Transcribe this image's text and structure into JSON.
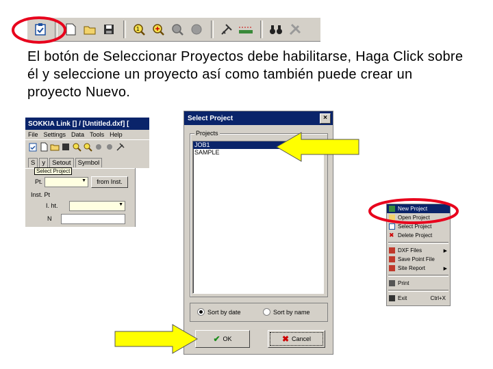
{
  "toolbar": {
    "buttons": [
      "select-project",
      "new",
      "open",
      "save",
      "zoom-extents",
      "zoom-in",
      "zoom-window",
      "pan",
      "draw",
      "measure",
      "find",
      "settings"
    ]
  },
  "instructions": {
    "text": "El botón de Seleccionar Proyectos debe habilitarse, Haga Click sobre él y seleccione un proyecto así como también puede crear un proyecto Nuevo."
  },
  "app": {
    "title": "SOKKIA Link  [] / [Untitled.dxf]  [",
    "menu": [
      "File",
      "Settings",
      "Data",
      "Tools",
      "Help"
    ],
    "tabs": [
      "S",
      "y",
      "Setout",
      "Symbol"
    ],
    "pt_label": "Pt.",
    "from_inst": "from Inst.",
    "inst_pt": "Inst. Pt",
    "ht_label": "I. ht.",
    "n_label": "N",
    "tooltip": "Select Project"
  },
  "dialog": {
    "title": "Select Project",
    "group_label": "Projects",
    "projects": [
      "JOB1",
      "SAMPLE"
    ],
    "selected_index": 0,
    "sort_by_date": "Sort by date",
    "sort_by_name": "Sort by name",
    "ok": "OK",
    "cancel": "Cancel",
    "close": "×"
  },
  "context_menu": {
    "items": [
      {
        "label": "New Project",
        "highlight": true
      },
      {
        "label": "Open Project",
        "highlight": false
      },
      {
        "label": "Select Project",
        "highlight": false
      },
      {
        "label": "Delete Project",
        "highlight": false
      }
    ],
    "items2": [
      {
        "label": "DXF Files",
        "submenu": true
      },
      {
        "label": "Save Point File",
        "submenu": false
      },
      {
        "label": "Site Report",
        "submenu": true
      }
    ],
    "print": "Print",
    "exit": "Exit",
    "exit_shortcut": "Ctrl+X"
  },
  "colors": {
    "highlight_circle": "#e8001c",
    "arrow_fill": "#ffff00",
    "titlebar": "#0a246a",
    "window_bg": "#d4d0c8"
  }
}
